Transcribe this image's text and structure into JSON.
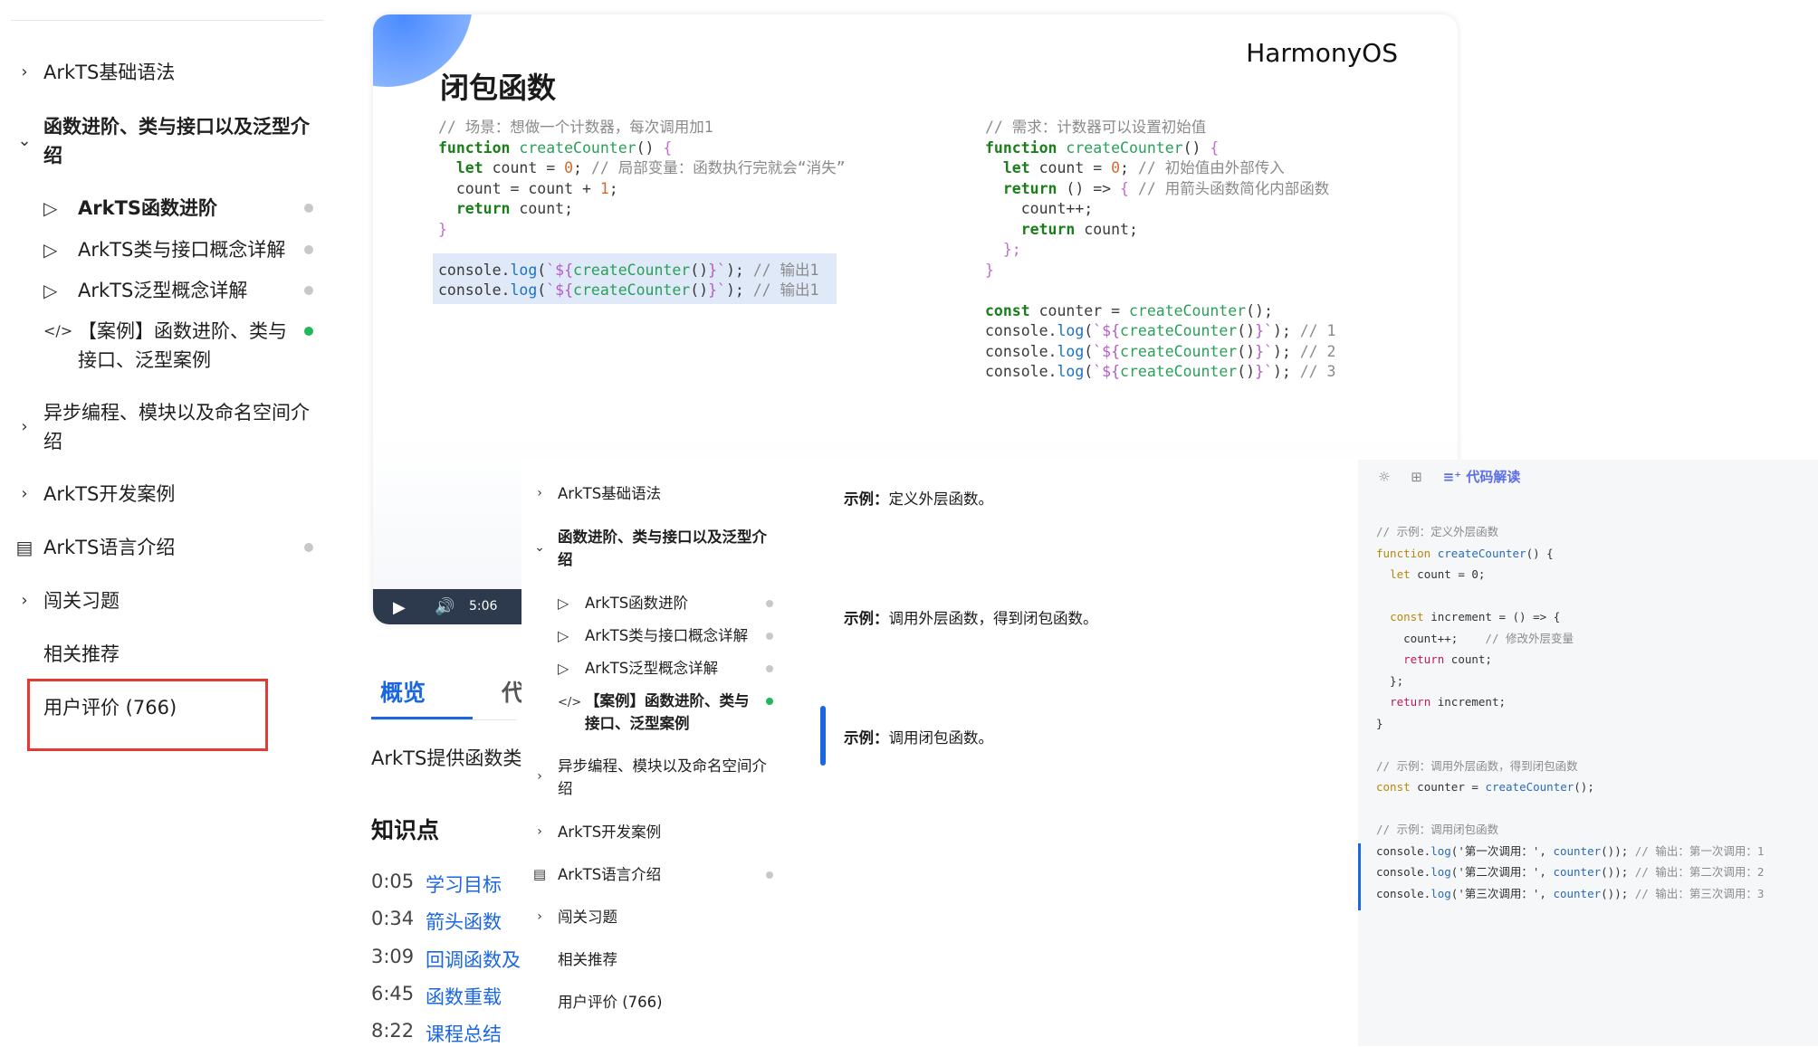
{
  "sidebar": {
    "items": [
      {
        "label": "ArkTS基础语法"
      },
      {
        "label": "函数进阶、类与接口以及泛型介",
        "label2": "绍"
      },
      {
        "label": "ArkTS函数进阶"
      },
      {
        "label": "ArkTS类与接口概念详解"
      },
      {
        "label": "ArkTS泛型概念详解"
      },
      {
        "label": "【案例】函数进阶、类与",
        "label2": "接口、泛型案例"
      },
      {
        "label": "异步编程、模块以及命名空间介",
        "label2": "绍"
      },
      {
        "label": "ArkTS开发案例"
      },
      {
        "label": "ArkTS语言介绍"
      },
      {
        "label": "闯关习题"
      },
      {
        "label": "相关推荐"
      },
      {
        "label": "用户评价 (766)"
      }
    ]
  },
  "slide": {
    "title": "闭包函数",
    "brand": "HarmonyOS",
    "left_comment": "// 场景：想做一个计数器，每次调用加1",
    "right_comment": "// 需求：计数器可以设置初始值",
    "time": "5:06"
  },
  "tabs": {
    "overview": "概览",
    "code": "代"
  },
  "intro": "ArkTS提供函数类",
  "knowledge": {
    "title": "知识点",
    "rows": [
      {
        "time": "0:05",
        "label": "学习目标"
      },
      {
        "time": "0:34",
        "label": "箭头函数"
      },
      {
        "time": "3:09",
        "label": "回调函数及"
      },
      {
        "time": "6:45",
        "label": "函数重载"
      },
      {
        "time": "8:22",
        "label": "课程总结"
      }
    ]
  },
  "popup": {
    "items": [
      {
        "label": "ArkTS基础语法"
      },
      {
        "label": "函数进阶、类与接口以及泛型介",
        "label2": "绍"
      },
      {
        "label": "ArkTS函数进阶"
      },
      {
        "label": "ArkTS类与接口概念详解"
      },
      {
        "label": "ArkTS泛型概念详解"
      },
      {
        "label": "【案例】函数进阶、类与",
        "label2": "接口、泛型案例"
      },
      {
        "label": "异步编程、模块以及命名空间介",
        "label2": "绍"
      },
      {
        "label": "ArkTS开发案例"
      },
      {
        "label": "ArkTS语言介绍"
      },
      {
        "label": "闯关习题"
      },
      {
        "label": "相关推荐"
      },
      {
        "label": "用户评价 (766)"
      }
    ],
    "examples": [
      {
        "prefix": "示例：",
        "text": "定义外层函数。"
      },
      {
        "prefix": "示例：",
        "text": "调用外层函数，得到闭包函数。"
      },
      {
        "prefix": "示例：",
        "text": "调用闭包函数。"
      }
    ]
  },
  "codepanel": {
    "toolbar": {
      "ai_label": "代码解读"
    }
  }
}
